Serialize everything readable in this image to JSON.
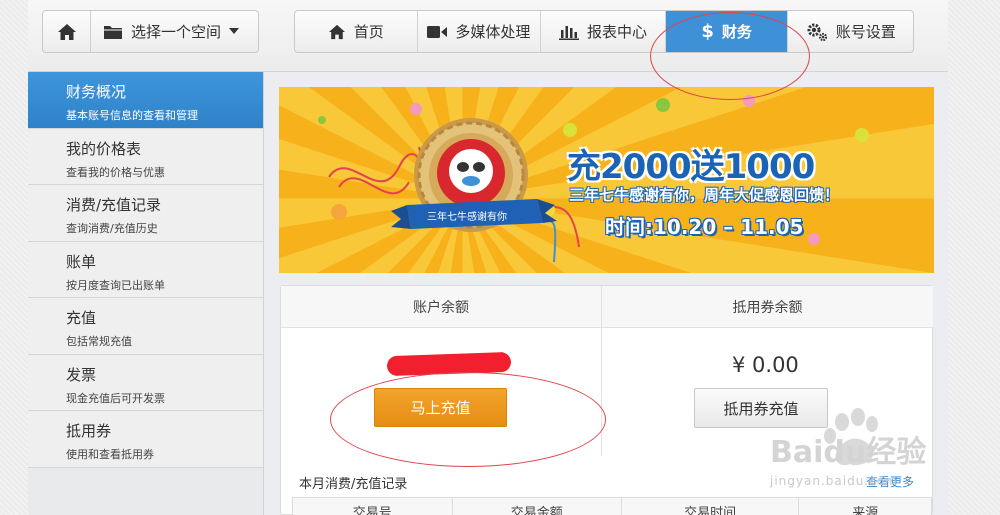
{
  "top_bar": {
    "space_selector_label": "选择一个空间",
    "nav_tabs": [
      {
        "label": "首页",
        "icon": "home-icon"
      },
      {
        "label": "多媒体处理",
        "icon": "video-camera-icon"
      },
      {
        "label": "报表中心",
        "icon": "bar-chart-icon"
      },
      {
        "label": "财务",
        "icon": "dollar-icon",
        "active": true
      },
      {
        "label": "账号设置",
        "icon": "gears-icon"
      }
    ]
  },
  "sidebar": {
    "items": [
      {
        "title": "财务概况",
        "subtitle": "基本账号信息的查看和管理",
        "active": true
      },
      {
        "title": "我的价格表",
        "subtitle": "查看我的价格与优惠"
      },
      {
        "title": "消费/充值记录",
        "subtitle": "查询消费/充值历史"
      },
      {
        "title": "账单",
        "subtitle": "按月度查询已出账单"
      },
      {
        "title": "充值",
        "subtitle": "包括常规充值"
      },
      {
        "title": "发票",
        "subtitle": "现金充值后可开发票"
      },
      {
        "title": "抵用券",
        "subtitle": "使用和查看抵用券"
      }
    ]
  },
  "banner": {
    "headline": "充2000送1000",
    "subline": "三年七牛感谢有你，周年大促感恩回馈！",
    "date_range": "时间:10.20 – 11.05",
    "ribbon_text": "三年七牛感谢有你"
  },
  "balance_panel": {
    "account_balance_label": "账户余额",
    "account_balance_value": "¥",
    "recharge_button": "马上充值",
    "voucher_balance_label": "抵用券余额",
    "voucher_balance_value": "¥ 0.00",
    "voucher_recharge_button": "抵用券充值"
  },
  "records": {
    "title": "本月消费/充值记录",
    "more_link": "查看更多",
    "columns": [
      "交易号",
      "交易金额",
      "交易时间",
      "来源"
    ]
  },
  "watermark": {
    "brand": "Baidu经验",
    "url": "jingyan.baidu.com"
  },
  "colors": {
    "active_blue": "#3e91d6",
    "recharge_orange": "#eb9a1f",
    "annotation_red": "#e2434c"
  }
}
